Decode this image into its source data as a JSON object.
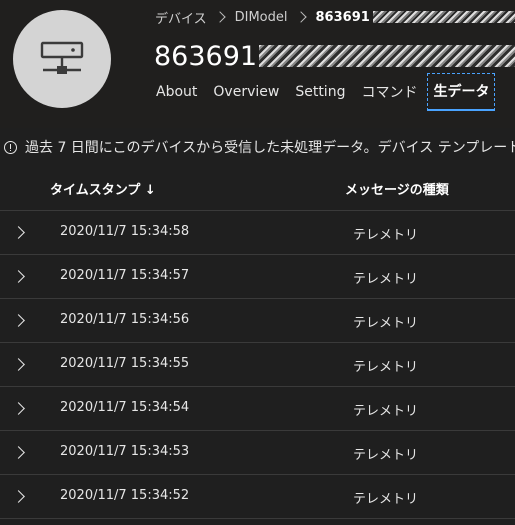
{
  "breadcrumb": {
    "root": "デバイス",
    "model": "DIModel",
    "current": "863691"
  },
  "device": {
    "title": "863691"
  },
  "tabs": [
    {
      "label": "About"
    },
    {
      "label": "Overview"
    },
    {
      "label": "Setting"
    },
    {
      "label": "コマンド"
    },
    {
      "label": "生データ",
      "active": true
    }
  ],
  "info": {
    "text": "過去 7 日間にこのデバイスから受信した未処理データ。デバイス テンプレート"
  },
  "table": {
    "headers": {
      "time": "タイムスタンプ ↓",
      "type": "メッセージの種類"
    },
    "rows": [
      {
        "time": "2020/11/7 15:34:58",
        "type": "テレメトリ"
      },
      {
        "time": "2020/11/7 15:34:57",
        "type": "テレメトリ"
      },
      {
        "time": "2020/11/7 15:34:56",
        "type": "テレメトリ"
      },
      {
        "time": "2020/11/7 15:34:55",
        "type": "テレメトリ"
      },
      {
        "time": "2020/11/7 15:34:54",
        "type": "テレメトリ"
      },
      {
        "time": "2020/11/7 15:34:53",
        "type": "テレメトリ"
      },
      {
        "time": "2020/11/7 15:34:52",
        "type": "テレメトリ"
      }
    ]
  },
  "colors": {
    "accent": "#4aa3ff",
    "background": "#1f1f1f",
    "avatar": "#d4d4d4"
  },
  "icons": {
    "avatar": "device-network-icon",
    "info": "info-icon",
    "expand": "chevron-right-icon"
  }
}
